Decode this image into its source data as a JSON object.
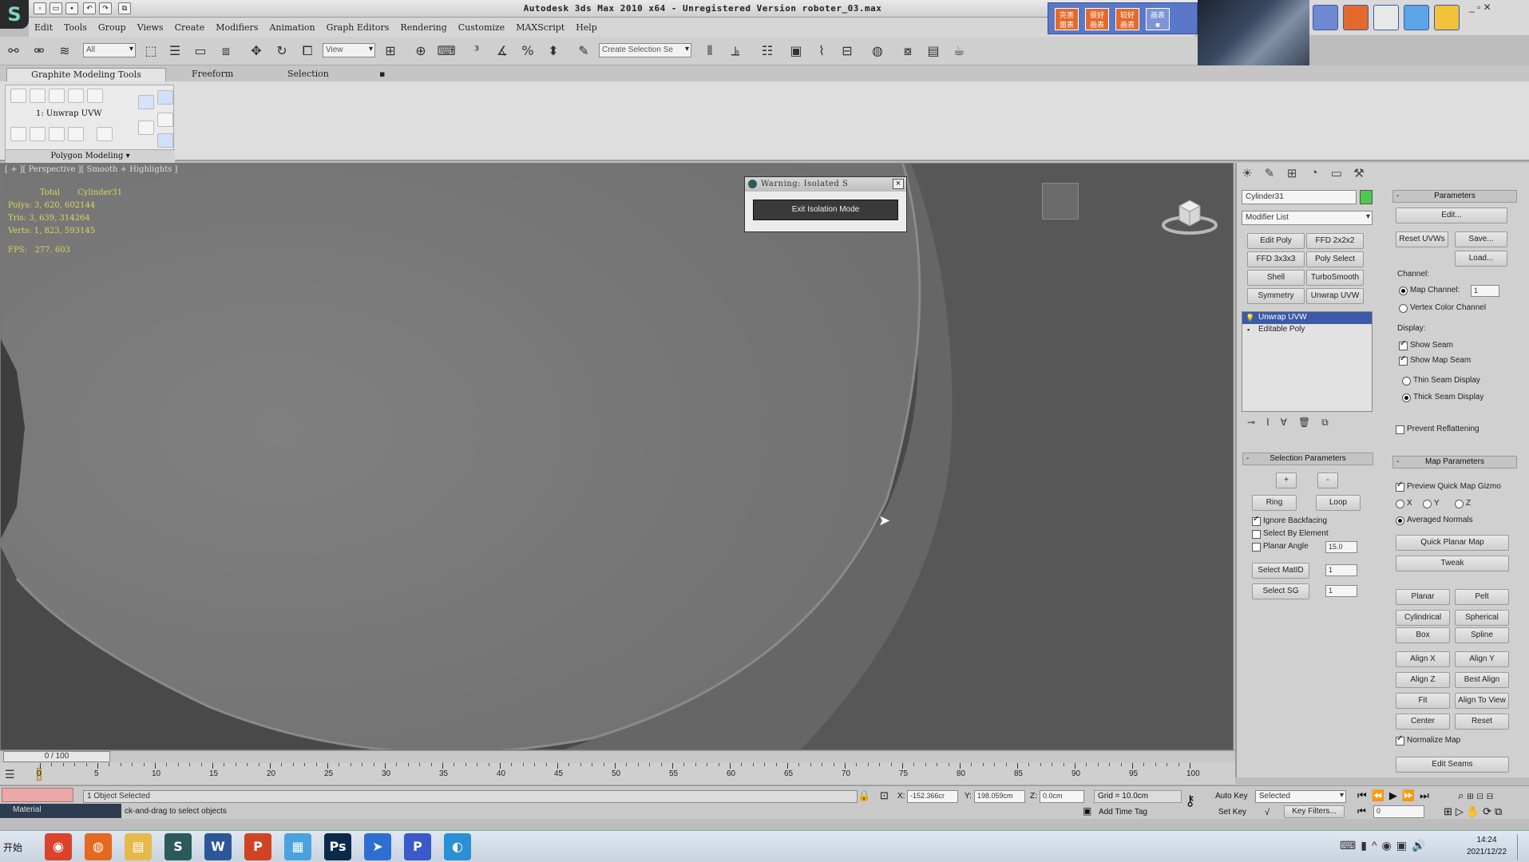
{
  "window": {
    "title": "Autodesk 3ds Max  2010 x64  - Unregistered Version  roboter_03.max",
    "app_logo": "S",
    "controls": "_ ▫ ✕"
  },
  "menu": [
    "Edit",
    "Tools",
    "Group",
    "Views",
    "Create",
    "Modifiers",
    "Animation",
    "Graph Editors",
    "Rendering",
    "Customize",
    "MAXScript",
    "Help"
  ],
  "toolbar": {
    "selection_filter": "All",
    "ref_coord": "View",
    "named_selection": "Create Selection Se"
  },
  "ime_keys": [
    "完善\n面表",
    "很好\n画表",
    "较好\n画表",
    "画表\n■"
  ],
  "ribbon": {
    "tabs": [
      "Graphite Modeling Tools",
      "Freeform",
      "Selection",
      "▪"
    ],
    "panel_label": "1: Unwrap UVW",
    "panel_footer": "Polygon Modeling"
  },
  "viewport": {
    "label": "[ + ][ Perspective ][ Smooth + Highlights ]",
    "stats": {
      "header_total": "Total",
      "header_obj": "Cylinder31",
      "polys_label": "Polys:",
      "polys_val": "3, 620, 602144",
      "tris_label": "Tris:",
      "tris_val": "3, 639, 314264",
      "verts_label": "Verts:",
      "verts_val": "1, 823, 593145",
      "fps_label": "FPS:",
      "fps_val": "277. 603"
    }
  },
  "warning_dialog": {
    "title": "Warning: Isolated S",
    "button": "Exit Isolation Mode"
  },
  "command_panel": {
    "object_name": "Cylinder31",
    "object_color": "#4ec94e",
    "modifier_list": "Modifier List",
    "quick_mods": [
      "Edit Poly",
      "FFD 2x2x2",
      "FFD 3x3x3",
      "Poly Select",
      "Shell",
      "TurboSmooth",
      "Symmetry",
      "Unwrap UVW"
    ],
    "stack": [
      "Unwrap UVW",
      "Editable Poly"
    ],
    "selection_params": {
      "header": "Selection Parameters",
      "plus": "+",
      "minus": "-",
      "ring": "Ring",
      "loop": "Loop",
      "ignore_backfacing": "Ignore Backfacing",
      "select_by_element": "Select By Element",
      "planar_angle": "Planar Angle",
      "planar_angle_val": "15.0",
      "select_matid": "Select MatID",
      "matid_val": "1",
      "select_sg": "Select SG",
      "sg_val": "1"
    },
    "parameters": {
      "header": "Parameters",
      "edit": "Edit...",
      "reset_uvws": "Reset UVWs",
      "save": "Save...",
      "load": "Load...",
      "channel": "Channel:",
      "map_channel": "Map Channel:",
      "map_channel_val": "1",
      "vertex_color_channel": "Vertex Color Channel",
      "display": "Display:",
      "show_seam": "Show Seam",
      "show_map_seam": "Show Map Seam",
      "thin_seam": "Thin Seam Display",
      "thick_seam": "Thick Seam Display",
      "prevent_reflattening": "Prevent Reflattening"
    },
    "map_params": {
      "header": "Map Parameters",
      "preview_quick_map": "Preview Quick Map Gizmo",
      "x": "X",
      "y": "Y",
      "z": "Z",
      "averaged_normals": "Averaged Normals",
      "quick_planar_map": "Quick Planar Map",
      "tweak": "Tweak",
      "grid_buttons": [
        "Planar",
        "Pelt",
        "Cylindrical",
        "Spherical",
        "Box",
        "Spline",
        "Align X",
        "Align Y",
        "Align Z",
        "Best Align",
        "Fit",
        "Align To View",
        "Center",
        "Reset"
      ],
      "normalize_map": "Normalize Map",
      "edit_seams": "Edit Seams"
    }
  },
  "timeline": {
    "slider": "0 / 100",
    "ticks": [
      "0",
      "5",
      "10",
      "15",
      "20",
      "25",
      "30",
      "35",
      "40",
      "45",
      "50",
      "55",
      "60",
      "65",
      "70",
      "75",
      "80",
      "85",
      "90",
      "95",
      "100"
    ]
  },
  "status": {
    "selected_text": "1 Object Selected",
    "prompt": "ck-and-drag to select objects",
    "material_label": "Material",
    "x_label": "X:",
    "x_val": "-152.366cr",
    "y_label": "Y:",
    "y_val": "198.059cm",
    "z_label": "Z:",
    "z_val": "0.0cm",
    "grid": "Grid = 10.0cm",
    "auto_key": "Auto Key",
    "set_key": "Set Key",
    "key_mode": "Selected",
    "key_filters": "Key Filters...",
    "frame_val": "0",
    "add_time_tag": "Add Time Tag"
  },
  "taskbar": {
    "start": "开始",
    "apps": [
      {
        "icon": "chrome-icon",
        "glyph": "◉",
        "color": "#d9442b"
      },
      {
        "icon": "firefox-icon",
        "glyph": "◍",
        "color": "#e36a1f"
      },
      {
        "icon": "explorer-icon",
        "glyph": "▤",
        "color": "#e6b94b"
      },
      {
        "icon": "3dsmax-icon",
        "glyph": "S",
        "color": "#2a5a5a"
      },
      {
        "icon": "word-icon",
        "glyph": "W",
        "color": "#2b5797"
      },
      {
        "icon": "powerpoint-icon",
        "glyph": "P",
        "color": "#d04423"
      },
      {
        "icon": "calculator-icon",
        "glyph": "▦",
        "color": "#4aa3df"
      },
      {
        "icon": "photoshop-icon",
        "glyph": "Ps",
        "color": "#0b2a4a"
      },
      {
        "icon": "feather-icon",
        "glyph": "➤",
        "color": "#2d6fd1"
      },
      {
        "icon": "p-app-icon",
        "glyph": "P",
        "color": "#3c59c9"
      },
      {
        "icon": "browser-icon",
        "glyph": "◐",
        "color": "#2a8fd3"
      }
    ],
    "time": "14:24",
    "date": "2021/12/22"
  }
}
